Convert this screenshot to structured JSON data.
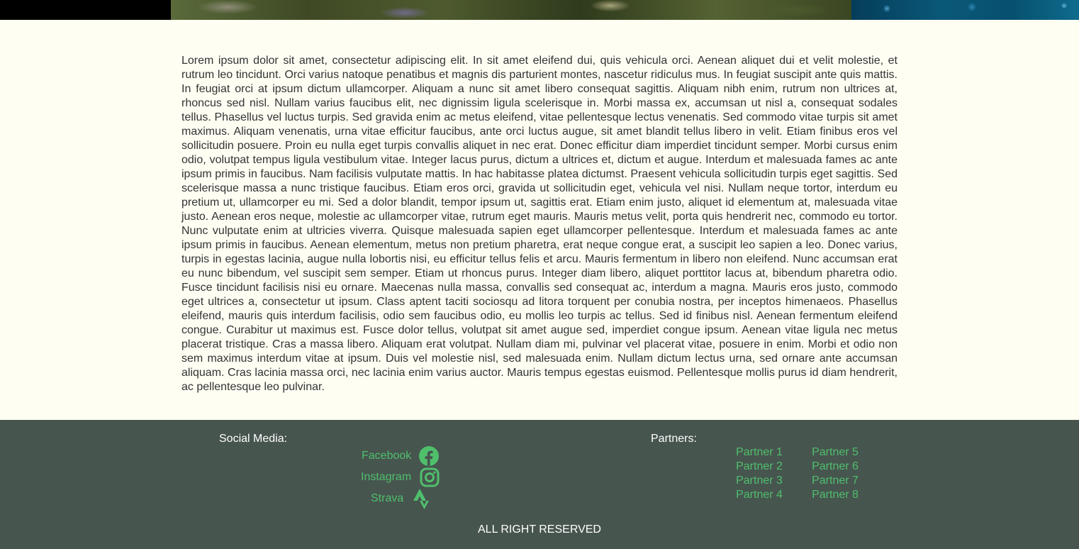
{
  "colors": {
    "page_bg": "#fefef3",
    "footer_bg": "#47554f",
    "link_green": "#4fbf6c",
    "text": "#333333"
  },
  "article": {
    "text": "Lorem ipsum dolor sit amet, consectetur adipiscing elit. In sit amet eleifend dui, quis vehicula orci. Aenean aliquet dui et velit molestie, et rutrum leo tincidunt. Orci varius natoque penatibus et magnis dis parturient montes, nascetur ridiculus mus. In feugiat suscipit ante quis mattis. In feugiat orci at ipsum dictum ullamcorper. Aliquam a nunc sit amet libero consequat sagittis. Aliquam nibh enim, rutrum non ultrices at, rhoncus sed nisl. Nullam varius faucibus elit, nec dignissim ligula scelerisque in. Morbi massa ex, accumsan ut nisl a, consequat sodales tellus. Phasellus vel luctus turpis. Sed gravida enim ac metus eleifend, vitae pellentesque lectus venenatis. Sed commodo vitae turpis sit amet maximus. Aliquam venenatis, urna vitae efficitur faucibus, ante orci luctus augue, sit amet blandit tellus libero in velit. Etiam finibus eros vel sollicitudin posuere. Proin eu nulla eget turpis convallis aliquet in nec erat. Donec efficitur diam imperdiet tincidunt semper. Morbi cursus enim odio, volutpat tempus ligula vestibulum vitae. Integer lacus purus, dictum a ultrices et, dictum et augue. Interdum et malesuada fames ac ante ipsum primis in faucibus. Nam facilisis vulputate mattis. In hac habitasse platea dictumst. Praesent vehicula sollicitudin turpis eget sagittis. Sed scelerisque massa a nunc tristique faucibus. Etiam eros orci, gravida ut sollicitudin eget, vehicula vel nisi. Nullam neque tortor, interdum eu pretium ut, ullamcorper eu mi. Sed a dolor blandit, tempor ipsum ut, sagittis erat. Etiam enim justo, aliquet id elementum at, malesuada vitae justo. Aenean eros neque, molestie ac ullamcorper vitae, rutrum eget mauris. Mauris metus velit, porta quis hendrerit nec, commodo eu tortor. Nunc vulputate enim at ultricies viverra. Quisque malesuada sapien eget ullamcorper pellentesque. Interdum et malesuada fames ac ante ipsum primis in faucibus. Aenean elementum, metus non pretium pharetra, erat neque congue erat, a suscipit leo sapien a leo. Donec varius, turpis in egestas lacinia, augue nulla lobortis nisi, eu efficitur tellus felis et arcu. Mauris fermentum in libero non eleifend. Nunc accumsan erat eu nunc bibendum, vel suscipit sem semper. Etiam ut rhoncus purus. Integer diam libero, aliquet porttitor lacus at, bibendum pharetra odio. Fusce tincidunt facilisis nisi eu ornare. Maecenas nulla massa, convallis sed consequat ac, interdum a magna. Mauris eros justo, commodo eget ultrices a, consectetur ut ipsum. Class aptent taciti sociosqu ad litora torquent per conubia nostra, per inceptos himenaeos. Phasellus eleifend, mauris quis interdum facilisis, odio sem faucibus odio, eu mollis leo turpis ac tellus. Sed id finibus nisl. Aenean fermentum eleifend congue. Curabitur ut maximus est. Fusce dolor tellus, volutpat sit amet augue sed, imperdiet congue ipsum. Aenean vitae ligula nec metus placerat tristique. Cras a massa libero. Aliquam erat volutpat. Nullam diam mi, pulvinar vel placerat vitae, posuere in enim. Morbi et odio non sem maximus interdum vitae at ipsum. Duis vel molestie nisl, sed malesuada enim. Nullam dictum lectus urna, sed ornare ante accumsan aliquam. Cras lacinia massa orci, nec lacinia enim varius auctor. Mauris tempus egestas euismod. Pellentesque mollis purus id diam hendrerit, ac pellentesque leo pulvinar."
  },
  "footer": {
    "social_heading": "Social Media:",
    "social": [
      {
        "label": "Facebook",
        "icon": "facebook-icon"
      },
      {
        "label": "Instagram",
        "icon": "instagram-icon"
      },
      {
        "label": "Strava",
        "icon": "strava-icon"
      }
    ],
    "partners_heading": "Partners:",
    "partners": [
      "Partner 1",
      "Partner 2",
      "Partner 3",
      "Partner 4",
      "Partner 5",
      "Partner 6",
      "Partner 7",
      "Partner 8"
    ],
    "copyright": "ALL RIGHT RESERVED"
  }
}
